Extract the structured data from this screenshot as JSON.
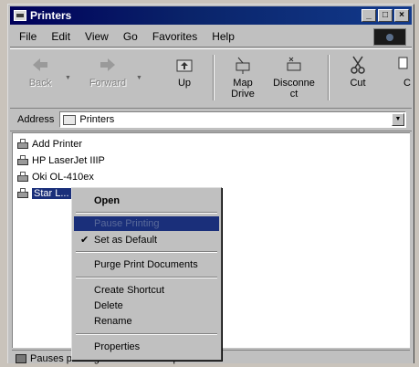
{
  "window": {
    "title": "Printers"
  },
  "menubar": {
    "items": [
      "File",
      "Edit",
      "View",
      "Go",
      "Favorites",
      "Help"
    ]
  },
  "toolbar": {
    "back": "Back",
    "forward": "Forward",
    "up": "Up",
    "map_drive": [
      "Map",
      "Drive"
    ],
    "disconnect": [
      "Disconne",
      "ct"
    ],
    "cut": "Cut",
    "copy": "C"
  },
  "address": {
    "label": "Address",
    "value": "Printers"
  },
  "printers": [
    "Add Printer",
    "HP LaserJet IIIP",
    "Oki OL-410ex",
    "Star L..."
  ],
  "context_menu": {
    "open": "Open",
    "pause": "Pause Printing",
    "set_default": "Set as Default",
    "purge": "Purge Print Documents",
    "create_shortcut": "Create Shortcut",
    "delete": "Delete",
    "rename": "Rename",
    "properties": "Properties"
  },
  "status": {
    "text": "Pauses printing on the selected printer."
  }
}
